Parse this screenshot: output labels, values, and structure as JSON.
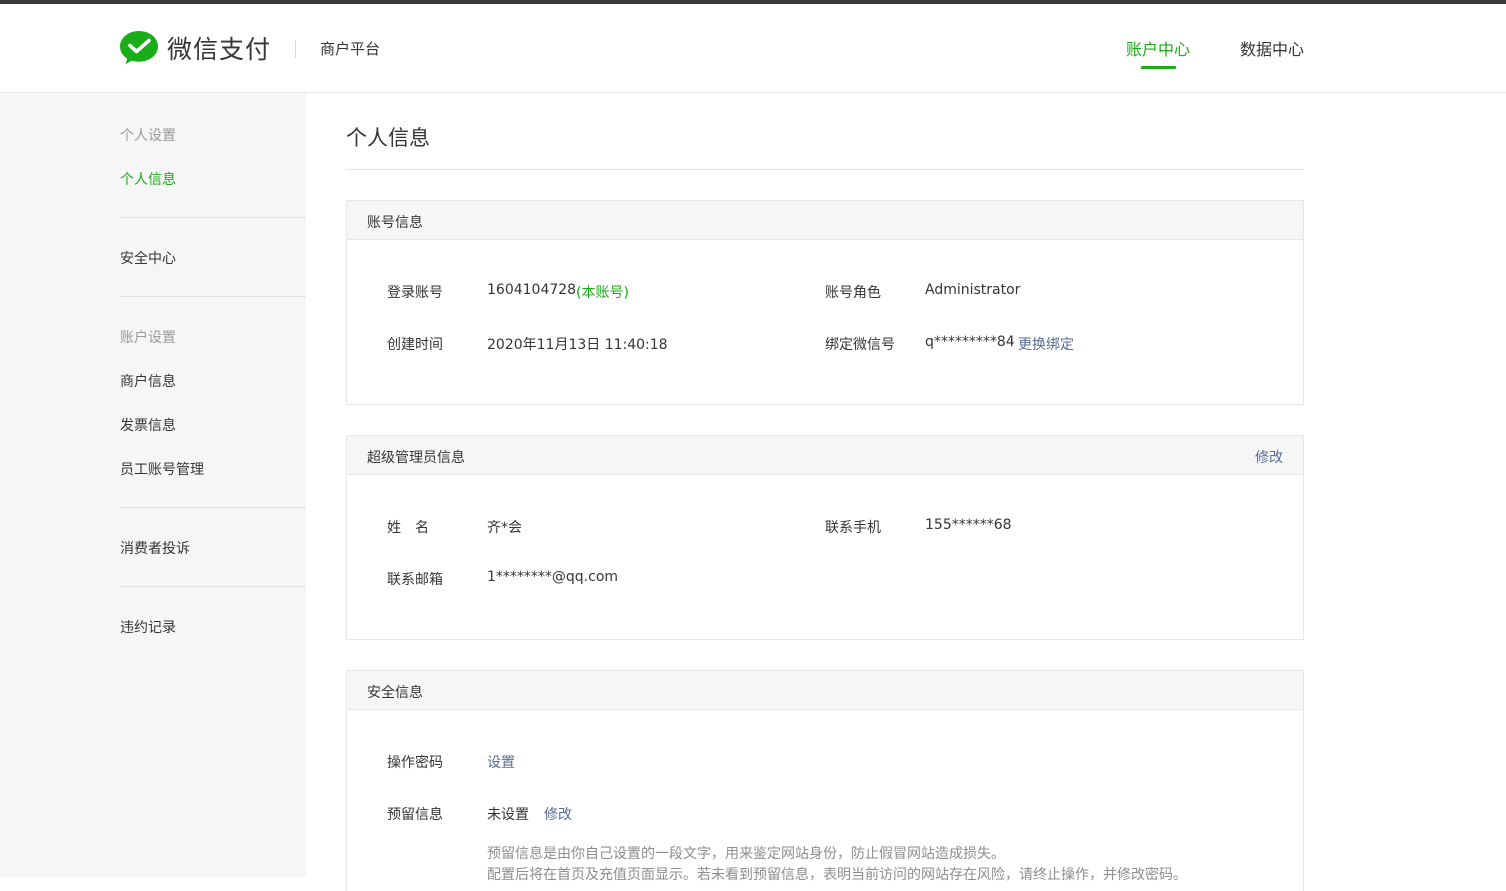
{
  "header": {
    "brand": "微信支付",
    "platform": "商户平台",
    "nav": [
      {
        "label": "账户中心",
        "active": true
      },
      {
        "label": "数据中心",
        "active": false
      }
    ]
  },
  "sidebar": {
    "group1": "个人设置",
    "item_personal": "个人信息",
    "item_security": "安全中心",
    "group2": "账户设置",
    "item_merchant": "商户信息",
    "item_invoice": "发票信息",
    "item_staff": "员工账号管理",
    "item_complaint": "消费者投诉",
    "item_violation": "违约记录"
  },
  "main": {
    "title": "个人信息",
    "account": {
      "heading": "账号信息",
      "login_label": "登录账号",
      "login_value": "1604104728",
      "login_tag": "(本账号)",
      "role_label": "账号角色",
      "role_value": "Administrator",
      "created_label": "创建时间",
      "created_value": "2020年11月13日 11:40:18",
      "wechat_label": "绑定微信号",
      "wechat_value": "q*********84",
      "wechat_action": "更换绑定"
    },
    "admin": {
      "heading": "超级管理员信息",
      "edit": "修改",
      "name_label": "姓　名",
      "name_value": "齐*会",
      "phone_label": "联系手机",
      "phone_value": "155******68",
      "email_label": "联系邮箱",
      "email_value": "1********@qq.com"
    },
    "security": {
      "heading": "安全信息",
      "op_label": "操作密码",
      "op_action": "设置",
      "reserve_label": "预留信息",
      "reserve_value": "未设置",
      "reserve_action": "修改",
      "note1": "预留信息是由你自己设置的一段文字，用来鉴定网站身份，防止假冒网站造成损失。",
      "note2": "配置后将在首页及充值页面显示。若未看到预留信息，表明当前访问的网站存在风险，请终止操作，并修改密码。"
    }
  },
  "colors": {
    "accent": "#1aad19",
    "link": "#576b95"
  }
}
